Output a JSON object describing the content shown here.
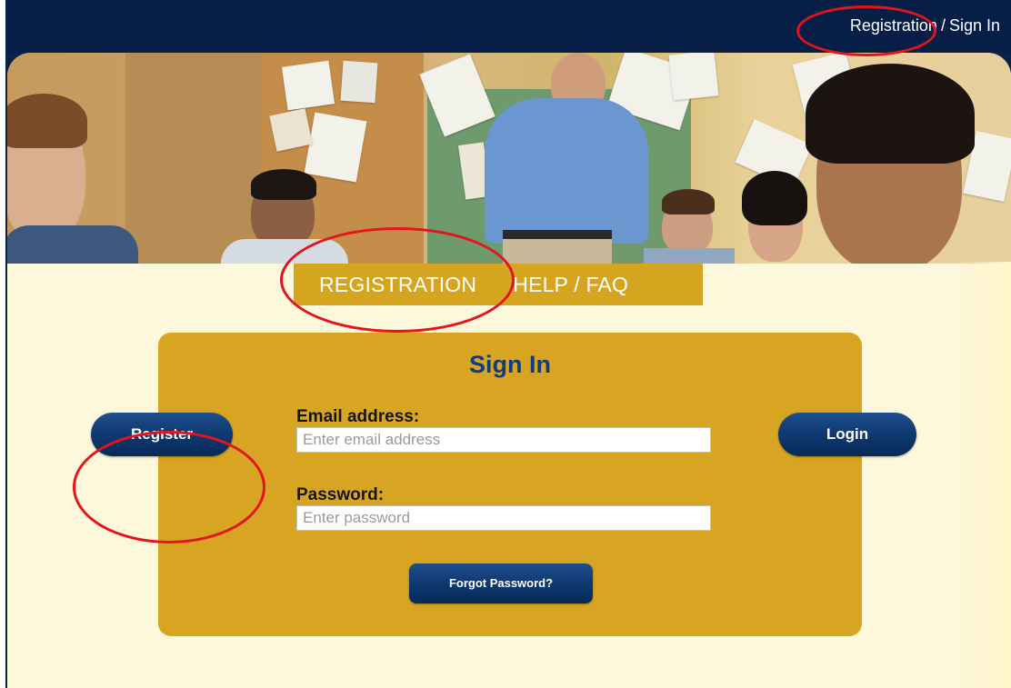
{
  "header": {
    "registration_link": "Registration",
    "separator": "/",
    "signin_link": "Sign In"
  },
  "nav": {
    "tabs": [
      {
        "label": "REGISTRATION"
      },
      {
        "label": "HELP / FAQ"
      }
    ]
  },
  "signin": {
    "title": "Sign In",
    "email_label": "Email address:",
    "email_placeholder": "Enter email address",
    "password_label": "Password:",
    "password_placeholder": "Enter password"
  },
  "buttons": {
    "register": "Register",
    "login": "Login",
    "forgot_password": "Forgot Password?"
  },
  "colors": {
    "navy": "#071f46",
    "gold": "#d6a51f",
    "title_blue": "#123b82",
    "background_cream": "#fdf7db",
    "annotation_red": "#e4131c"
  }
}
